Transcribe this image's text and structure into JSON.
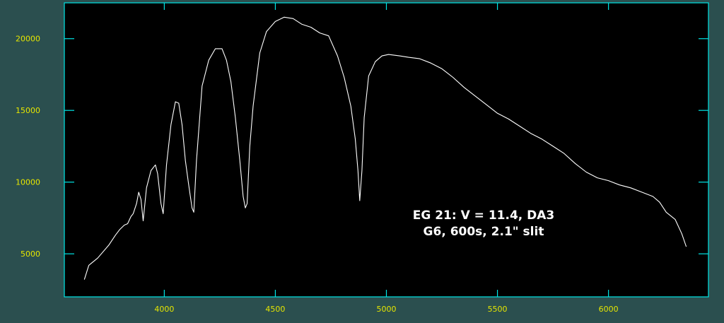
{
  "chart_data": {
    "type": "line",
    "title": "",
    "xlabel": "",
    "ylabel": "",
    "xlim": [
      3550,
      6450
    ],
    "ylim": [
      2000,
      22500
    ],
    "x_ticks": [
      4000,
      4500,
      5000,
      5500,
      6000
    ],
    "y_ticks": [
      5000,
      10000,
      15000,
      20000
    ],
    "annotations": [
      "EG 21: V = 11.4, DA3",
      "G6, 600s, 2.1\" slit"
    ],
    "colors": {
      "background": "#2b4f4f",
      "plot_area": "#000000",
      "frame": "#00e5e5",
      "tick_labels": "#e6e600",
      "line": "#ffffff"
    },
    "series": [
      {
        "x": [
          3640,
          3660,
          3700,
          3750,
          3780,
          3800,
          3820,
          3835,
          3850,
          3860,
          3875,
          3885,
          3895,
          3905,
          3920,
          3940,
          3960,
          3970,
          3985,
          3995,
          4010,
          4030,
          4050,
          4065,
          4080,
          4095,
          4110,
          4125,
          4133,
          4145,
          4170,
          4200,
          4230,
          4260,
          4280,
          4300,
          4320,
          4340,
          4355,
          4365,
          4373,
          4385,
          4400,
          4430,
          4460,
          4500,
          4540,
          4580,
          4620,
          4660,
          4700,
          4740,
          4780,
          4810,
          4840,
          4860,
          4872,
          4880,
          4890,
          4900,
          4920,
          4950,
          4980,
          5010,
          5060,
          5100,
          5150,
          5200,
          5250,
          5300,
          5350,
          5400,
          5450,
          5500,
          5550,
          5600,
          5650,
          5700,
          5750,
          5800,
          5850,
          5900,
          5950,
          6000,
          6050,
          6100,
          6150,
          6200,
          6230,
          6260,
          6300,
          6330,
          6350
        ],
        "y": [
          3200,
          4200,
          4700,
          5600,
          6300,
          6700,
          7000,
          7100,
          7600,
          7800,
          8500,
          9300,
          8800,
          7300,
          9600,
          10800,
          11200,
          10600,
          8500,
          7800,
          11200,
          14000,
          15600,
          15500,
          14000,
          11500,
          9800,
          8200,
          7900,
          11500,
          16700,
          18500,
          19300,
          19300,
          18500,
          17000,
          14500,
          11500,
          9000,
          8200,
          8500,
          12500,
          15300,
          19000,
          20500,
          21200,
          21500,
          21400,
          21000,
          20800,
          20400,
          20200,
          18800,
          17300,
          15300,
          13000,
          10800,
          8700,
          10800,
          14500,
          17400,
          18400,
          18800,
          18900,
          18800,
          18700,
          18600,
          18300,
          17900,
          17300,
          16600,
          16000,
          15400,
          14800,
          14400,
          13900,
          13400,
          13000,
          12500,
          12000,
          11300,
          10700,
          10300,
          10100,
          9800,
          9600,
          9300,
          9000,
          8600,
          7900,
          7400,
          6400,
          5500
        ]
      }
    ]
  }
}
